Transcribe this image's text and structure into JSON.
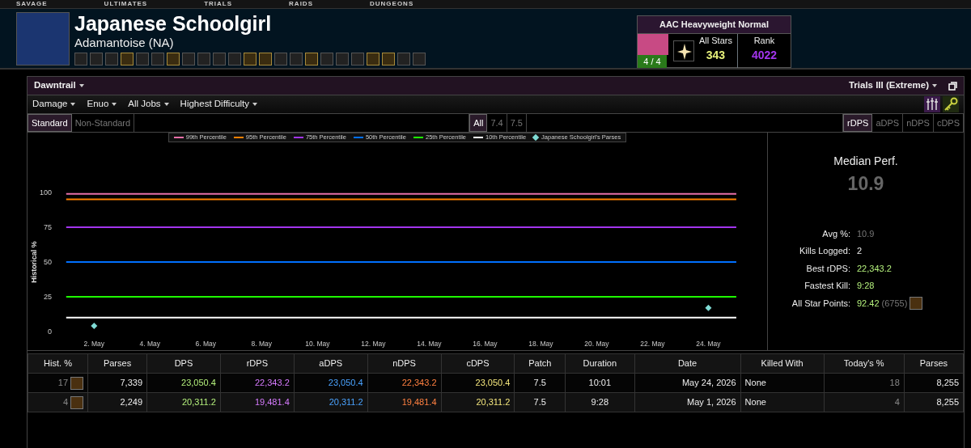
{
  "top_nav": [
    "SAVAGE",
    "ULTIMATES",
    "TRIALS",
    "RAIDS",
    "DUNGEONS"
  ],
  "character": {
    "name": "Japanese Schoolgirl",
    "server": "Adamantoise (NA)",
    "jobs": [
      {
        "ranked": false
      },
      {
        "ranked": false
      },
      {
        "ranked": false
      },
      {
        "ranked": true
      },
      {
        "ranked": false
      },
      {
        "ranked": false
      },
      {
        "ranked": true
      },
      {
        "ranked": false
      },
      {
        "ranked": false
      },
      {
        "ranked": false
      },
      {
        "ranked": false
      },
      {
        "ranked": true
      },
      {
        "ranked": true
      },
      {
        "ranked": false
      },
      {
        "ranked": false
      },
      {
        "ranked": true
      },
      {
        "ranked": false
      },
      {
        "ranked": false
      },
      {
        "ranked": false
      },
      {
        "ranked": true
      },
      {
        "ranked": true
      },
      {
        "ranked": false
      },
      {
        "ranked": false
      }
    ]
  },
  "achievement": {
    "title": "AAC Heavyweight Normal",
    "progress": "4 / 4",
    "all_stars_label": "All Stars",
    "all_stars": "343",
    "rank_label": "Rank",
    "rank": "4022"
  },
  "expansion": "Dawntrail",
  "zone": "Trials III (Extreme)",
  "filters": [
    "Damage",
    "Enuo",
    "All Jobs",
    "Highest Difficulty"
  ],
  "partition_tabs": [
    {
      "label": "Standard",
      "selected": true
    },
    {
      "label": "Non-Standard",
      "selected": false
    }
  ],
  "patch_tabs": [
    {
      "label": "All",
      "selected": true
    },
    {
      "label": "7.4",
      "selected": false
    },
    {
      "label": "7.5",
      "selected": false
    }
  ],
  "metric_tabs": [
    {
      "label": "rDPS",
      "selected": true
    },
    {
      "label": "aDPS",
      "selected": false
    },
    {
      "label": "nDPS",
      "selected": false
    },
    {
      "label": "cDPS",
      "selected": false
    }
  ],
  "chart_data": {
    "type": "line",
    "legend": "top",
    "ylabel": "Historical %",
    "ylim": [
      0,
      100
    ],
    "yticks": [
      0,
      25,
      50,
      75,
      100
    ],
    "categories": [
      null,
      "2. May",
      null,
      "4. May",
      null,
      "6. May",
      null,
      "8. May",
      null,
      "10. May",
      null,
      "12. May",
      null,
      "14. May",
      null,
      "16. May",
      null,
      "18. May",
      null,
      "20. May",
      null,
      "22. May",
      null,
      "24. May",
      null
    ],
    "series": [
      {
        "name": "99th Percentile",
        "color": "#e86fa8",
        "values": [
          99,
          99,
          99,
          99,
          99,
          99,
          99,
          99,
          99,
          99,
          99,
          99,
          99,
          99,
          99,
          99,
          99,
          99,
          99,
          99,
          99,
          99,
          99,
          99,
          99
        ]
      },
      {
        "name": "95th Percentile",
        "color": "#ff8000",
        "values": [
          95,
          95,
          95,
          95,
          95,
          95,
          95,
          95,
          95,
          95,
          95,
          95,
          95,
          95,
          95,
          95,
          95,
          95,
          95,
          95,
          95,
          95,
          95,
          95,
          95
        ]
      },
      {
        "name": "75th Percentile",
        "color": "#a335ee",
        "values": [
          75,
          75,
          75,
          75,
          75,
          75,
          75,
          75,
          75,
          75,
          75,
          75,
          75,
          75,
          75,
          75,
          75,
          75,
          75,
          75,
          75,
          75,
          75,
          75,
          75
        ]
      },
      {
        "name": "50th Percentile",
        "color": "#0070ff",
        "values": [
          50,
          50,
          50,
          50,
          50,
          50,
          50,
          50,
          50,
          50,
          50,
          50,
          50,
          50,
          50,
          50,
          50,
          50,
          50,
          50,
          50,
          50,
          50,
          50,
          50
        ]
      },
      {
        "name": "25th Percentile",
        "color": "#1eff00",
        "values": [
          25,
          25,
          25,
          25,
          25,
          25,
          25,
          25,
          25,
          25,
          25,
          25,
          25,
          25,
          25,
          25,
          25,
          25,
          25,
          25,
          25,
          25,
          25,
          25,
          25
        ]
      },
      {
        "name": "10th Percentile",
        "color": "#ffffff",
        "values": [
          10,
          10,
          10,
          10,
          10,
          10,
          10,
          10,
          10,
          10,
          10,
          10,
          10,
          10,
          10,
          10,
          10,
          10,
          10,
          10,
          10,
          10,
          10,
          10,
          10
        ]
      },
      {
        "name": "Japanese Schoolgirl's Parses",
        "color": "#7fdbd4",
        "type": "scatter",
        "values": [
          null,
          4,
          null,
          null,
          null,
          null,
          null,
          null,
          null,
          null,
          null,
          null,
          null,
          null,
          null,
          null,
          null,
          null,
          null,
          null,
          null,
          null,
          null,
          17,
          null
        ]
      }
    ]
  },
  "summary": {
    "title": "Median Perf.",
    "value": "10.9",
    "stats": [
      {
        "label": "Avg %:",
        "value": "10.9",
        "kind": "muted"
      },
      {
        "label": "Kills Logged:",
        "value": "2",
        "kind": "plain"
      },
      {
        "label": "Best rDPS:",
        "value": "22,343.2",
        "kind": "good"
      },
      {
        "label": "Fastest Kill:",
        "value": "9:28",
        "kind": "good"
      },
      {
        "label": "All Star Points:",
        "value": "92.42",
        "extra": "(6755)",
        "kind": "good"
      }
    ]
  },
  "table": {
    "columns": [
      "Hist. %",
      "Parses",
      "DPS",
      "rDPS",
      "aDPS",
      "nDPS",
      "cDPS",
      "Patch",
      "Duration",
      "Date",
      "Killed With",
      "Today's %",
      "Parses"
    ],
    "rows": [
      [
        "17",
        "7,339",
        "23,050.4",
        "22,343.2",
        "23,050.4",
        "22,343.2",
        "23,050.4",
        "7.5",
        "10:01",
        "May 24, 2026",
        "None",
        "18",
        "8,255"
      ],
      [
        "4",
        "2,249",
        "20,311.2",
        "19,481.4",
        "20,311.2",
        "19,481.4",
        "20,311.2",
        "7.5",
        "9:28",
        "May 1, 2026",
        "None",
        "4",
        "8,255"
      ]
    ]
  }
}
